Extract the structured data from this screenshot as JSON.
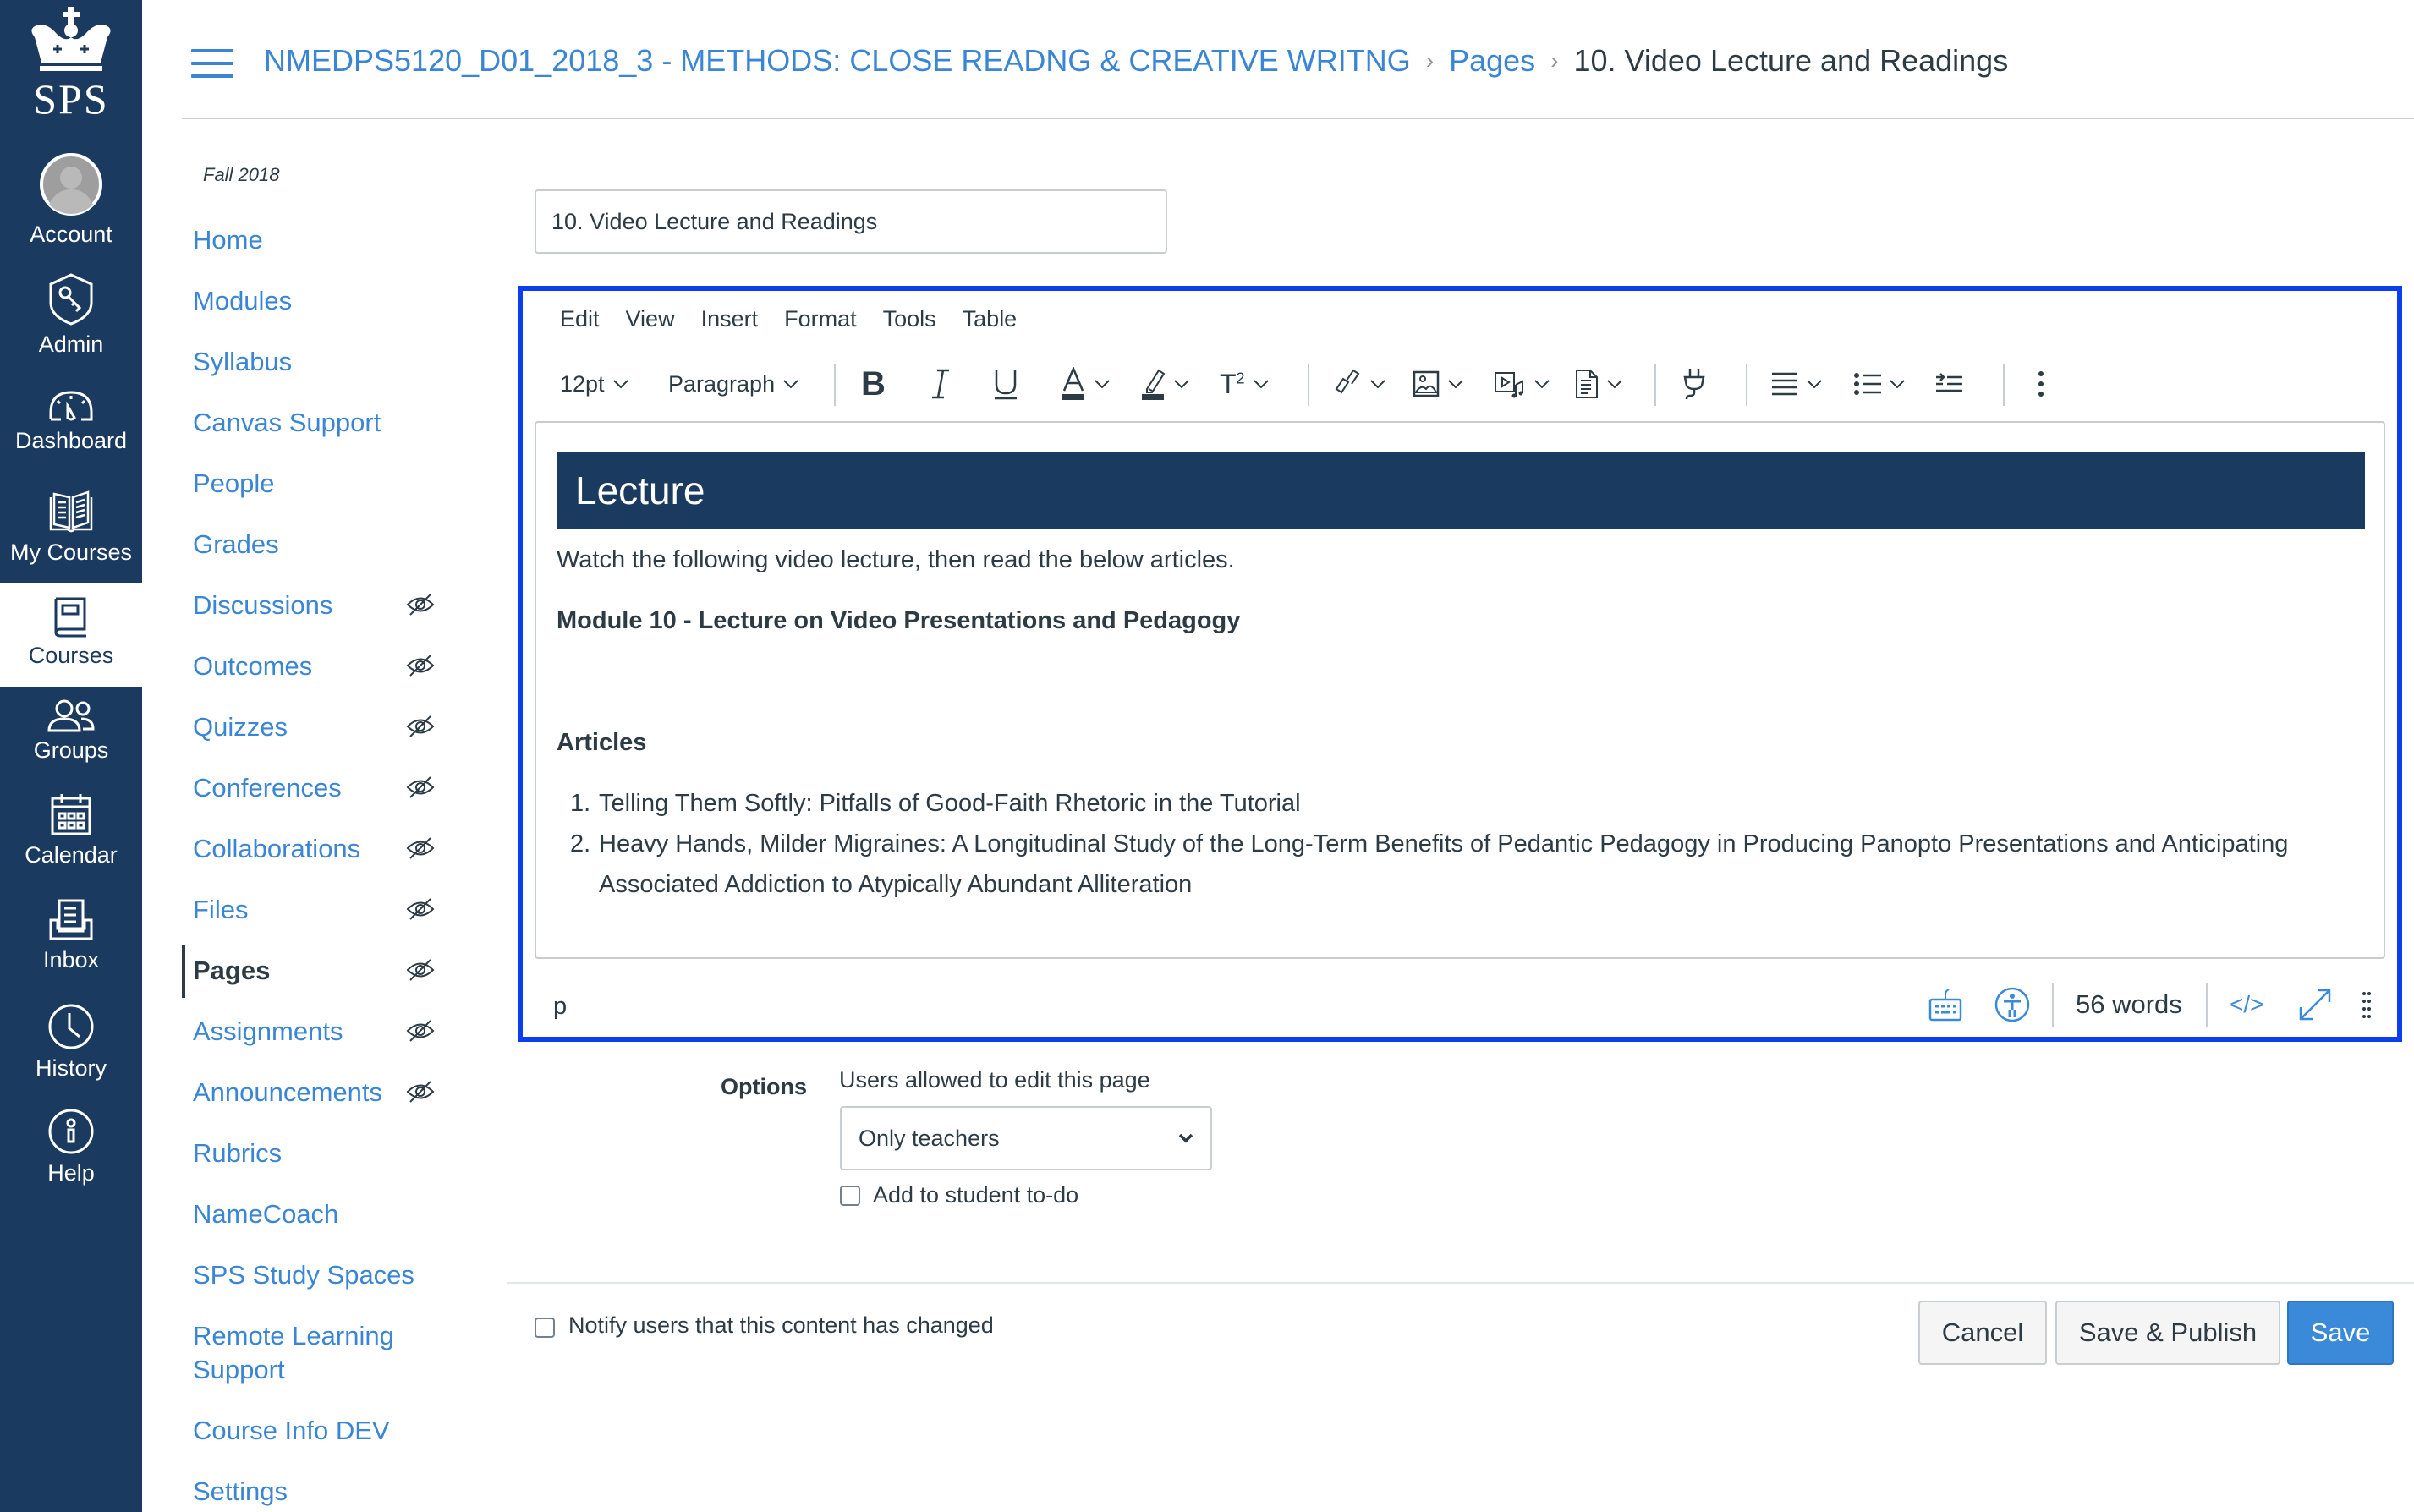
{
  "global_nav": {
    "logo_text": "SPS",
    "items": [
      {
        "label": "Account",
        "icon": "avatar-icon"
      },
      {
        "label": "Admin",
        "icon": "admin-shield-key-icon"
      },
      {
        "label": "Dashboard",
        "icon": "dashboard-gauge-icon"
      },
      {
        "label": "My Courses",
        "icon": "open-book-icon"
      },
      {
        "label": "Courses",
        "icon": "courses-book-icon",
        "active": true
      },
      {
        "label": "Groups",
        "icon": "groups-people-icon"
      },
      {
        "label": "Calendar",
        "icon": "calendar-icon"
      },
      {
        "label": "Inbox",
        "icon": "inbox-tray-icon"
      },
      {
        "label": "History",
        "icon": "clock-icon"
      },
      {
        "label": "Help",
        "icon": "info-circle-icon"
      }
    ]
  },
  "header": {
    "breadcrumb": [
      {
        "label": "NMEDPS5120_D01_2018_3 - METHODS: CLOSE READNG & CREATIVE WRITNG",
        "link": true
      },
      {
        "label": "Pages",
        "link": true
      },
      {
        "label": "10. Video Lecture and Readings",
        "link": false
      }
    ]
  },
  "course_nav": {
    "term": "Fall 2018",
    "items": [
      {
        "label": "Home",
        "hidden": false
      },
      {
        "label": "Modules",
        "hidden": false
      },
      {
        "label": "Syllabus",
        "hidden": false
      },
      {
        "label": "Canvas Support",
        "hidden": false
      },
      {
        "label": "People",
        "hidden": false
      },
      {
        "label": "Grades",
        "hidden": false
      },
      {
        "label": "Discussions",
        "hidden": true
      },
      {
        "label": "Outcomes",
        "hidden": true
      },
      {
        "label": "Quizzes",
        "hidden": true
      },
      {
        "label": "Conferences",
        "hidden": true
      },
      {
        "label": "Collaborations",
        "hidden": true
      },
      {
        "label": "Files",
        "hidden": true
      },
      {
        "label": "Pages",
        "hidden": true,
        "active": true
      },
      {
        "label": "Assignments",
        "hidden": true
      },
      {
        "label": "Announcements",
        "hidden": true
      },
      {
        "label": "Rubrics",
        "hidden": false
      },
      {
        "label": "NameCoach",
        "hidden": false
      },
      {
        "label": "SPS Study Spaces",
        "hidden": false
      },
      {
        "label": "Remote Learning Support",
        "hidden": false
      },
      {
        "label": "Course Info DEV",
        "hidden": false
      },
      {
        "label": "Settings",
        "hidden": false
      }
    ]
  },
  "page_title_input": {
    "value": "10. Video Lecture and Readings"
  },
  "editor": {
    "menubar": [
      "Edit",
      "View",
      "Insert",
      "Format",
      "Tools",
      "Table"
    ],
    "toolbar": {
      "font_size": "12pt",
      "block_format": "Paragraph",
      "buttons": [
        "bold",
        "italic",
        "underline",
        "text-color",
        "highlight-color",
        "superscript",
        "link",
        "image",
        "media",
        "document",
        "apps-plugin",
        "align",
        "list",
        "indent",
        "more"
      ]
    },
    "content": {
      "banner_heading": "Lecture",
      "intro": "Watch the following video lecture, then read the below articles.",
      "module_heading": "Module 10 - Lecture on Video Presentations and Pedagogy",
      "articles_heading": "Articles",
      "articles": [
        "Telling Them Softly: Pitfalls of Good-Faith Rhetoric in the Tutorial",
        "Heavy Hands, Milder Migraines: A Longitudinal Study of the Long-Term Benefits of Pedantic Pedagogy in Producing Panopto Presentations and Anticipating Associated Addiction to Atypically Abundant Alliteration"
      ]
    },
    "statusbar": {
      "element_path": "p",
      "word_count": "56 words",
      "html_toggle": "</>"
    },
    "colors": {
      "focus_border": "#0b3ef2",
      "banner": "#1b3a5f"
    }
  },
  "options": {
    "label": "Options",
    "edit_permission_label": "Users allowed to edit this page",
    "edit_permission_value": "Only teachers",
    "student_todo_label": "Add to student to-do",
    "student_todo_checked": false
  },
  "footer": {
    "notify_label": "Notify users that this content has changed",
    "notify_checked": false,
    "cancel_label": "Cancel",
    "save_publish_label": "Save & Publish",
    "save_label": "Save"
  }
}
